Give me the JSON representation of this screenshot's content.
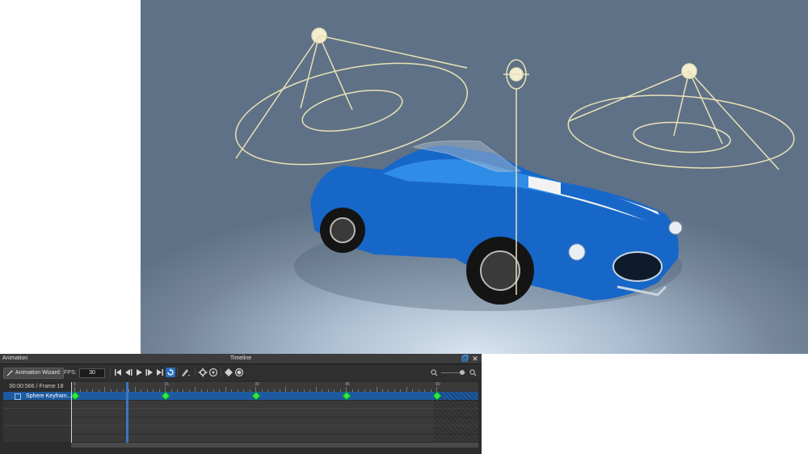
{
  "viewport": {
    "scene": "3D viewport with blue roadster and three spot lights",
    "colors": {
      "background": "#6a7b8f",
      "light_gizmo": "#e8e2b8",
      "car_body": "#1a6fd0",
      "stripe": "#f2f2f2"
    }
  },
  "panel": {
    "left_title": "Animation",
    "center_title": "Timeline",
    "restore_icon": "restore-icon",
    "close_label": "✕"
  },
  "toolbar": {
    "wizard_label": "Animation Wizard",
    "fps_label": "FPS:",
    "fps_value": "30",
    "icons": [
      "go-to-start-icon",
      "prev-key-icon",
      "play-icon",
      "next-key-icon",
      "go-to-end-icon",
      "loop-icon",
      "key-filter-icon",
      "gear-icon",
      "settings-icon",
      "add-key-icon",
      "record-icon",
      "zoom-out-icon",
      "zoom-in-icon"
    ]
  },
  "timeline": {
    "time_display": "00:00:566 / Frame 18",
    "ruler_labels": [
      "0",
      "15",
      "30",
      "45",
      "60"
    ],
    "tracks": [
      {
        "label": "Sphere Keyfram...",
        "checked": true,
        "selected": true,
        "keyframes": [
          0,
          15,
          30,
          45,
          60
        ]
      }
    ],
    "current_frame": 18,
    "total_frames": 60
  }
}
